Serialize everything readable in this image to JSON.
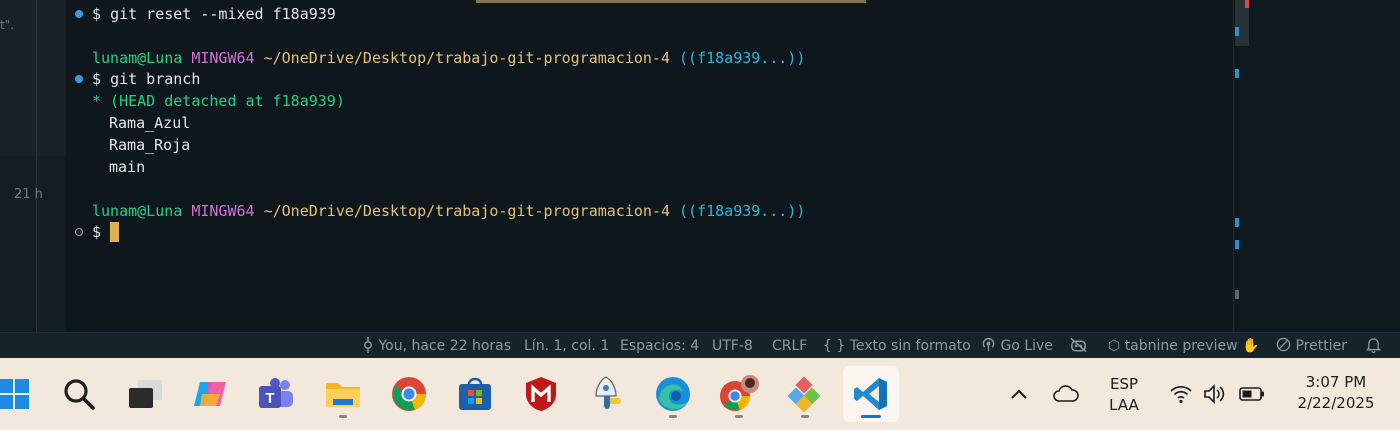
{
  "editor": {
    "gutter_fragment": "t\".",
    "blame_age": "21 h"
  },
  "terminal": {
    "line1": {
      "prompt": "$",
      "command": "git reset --mixed f18a939"
    },
    "prompt_user": "lunam@Luna",
    "prompt_env": "MINGW64",
    "prompt_path": "~/OneDrive/Desktop/trabajo-git-programacion-4",
    "prompt_branch": "((f18a939...))",
    "line2": {
      "prompt": "$",
      "command": "git branch"
    },
    "branch_output": {
      "detached": "* (HEAD detached at f18a939)",
      "branches": [
        "Rama_Azul",
        "Rama_Roja",
        "main"
      ]
    },
    "final_prompt": "$"
  },
  "statusbar": {
    "blame": "You, hace 22 horas",
    "position": "Lín. 1, col. 1",
    "spaces": "Espacios: 4",
    "encoding": "UTF-8",
    "eol": "CRLF",
    "language_icon": "{ }",
    "language": "Texto sin formato",
    "golive": "Go Live",
    "tabnine": "tabnine preview",
    "prettier": "Prettier"
  },
  "taskbar": {
    "apps": [
      "start",
      "search",
      "task-view",
      "copilot",
      "teams",
      "file-explorer",
      "chrome",
      "microsoft-store",
      "mcafee",
      "python-launcher",
      "edge",
      "chrome-profile",
      "git-tool",
      "vscode"
    ],
    "language_line1": "ESP",
    "language_line2": "LAA",
    "time": "3:07 PM",
    "date": "2/22/2025"
  }
}
